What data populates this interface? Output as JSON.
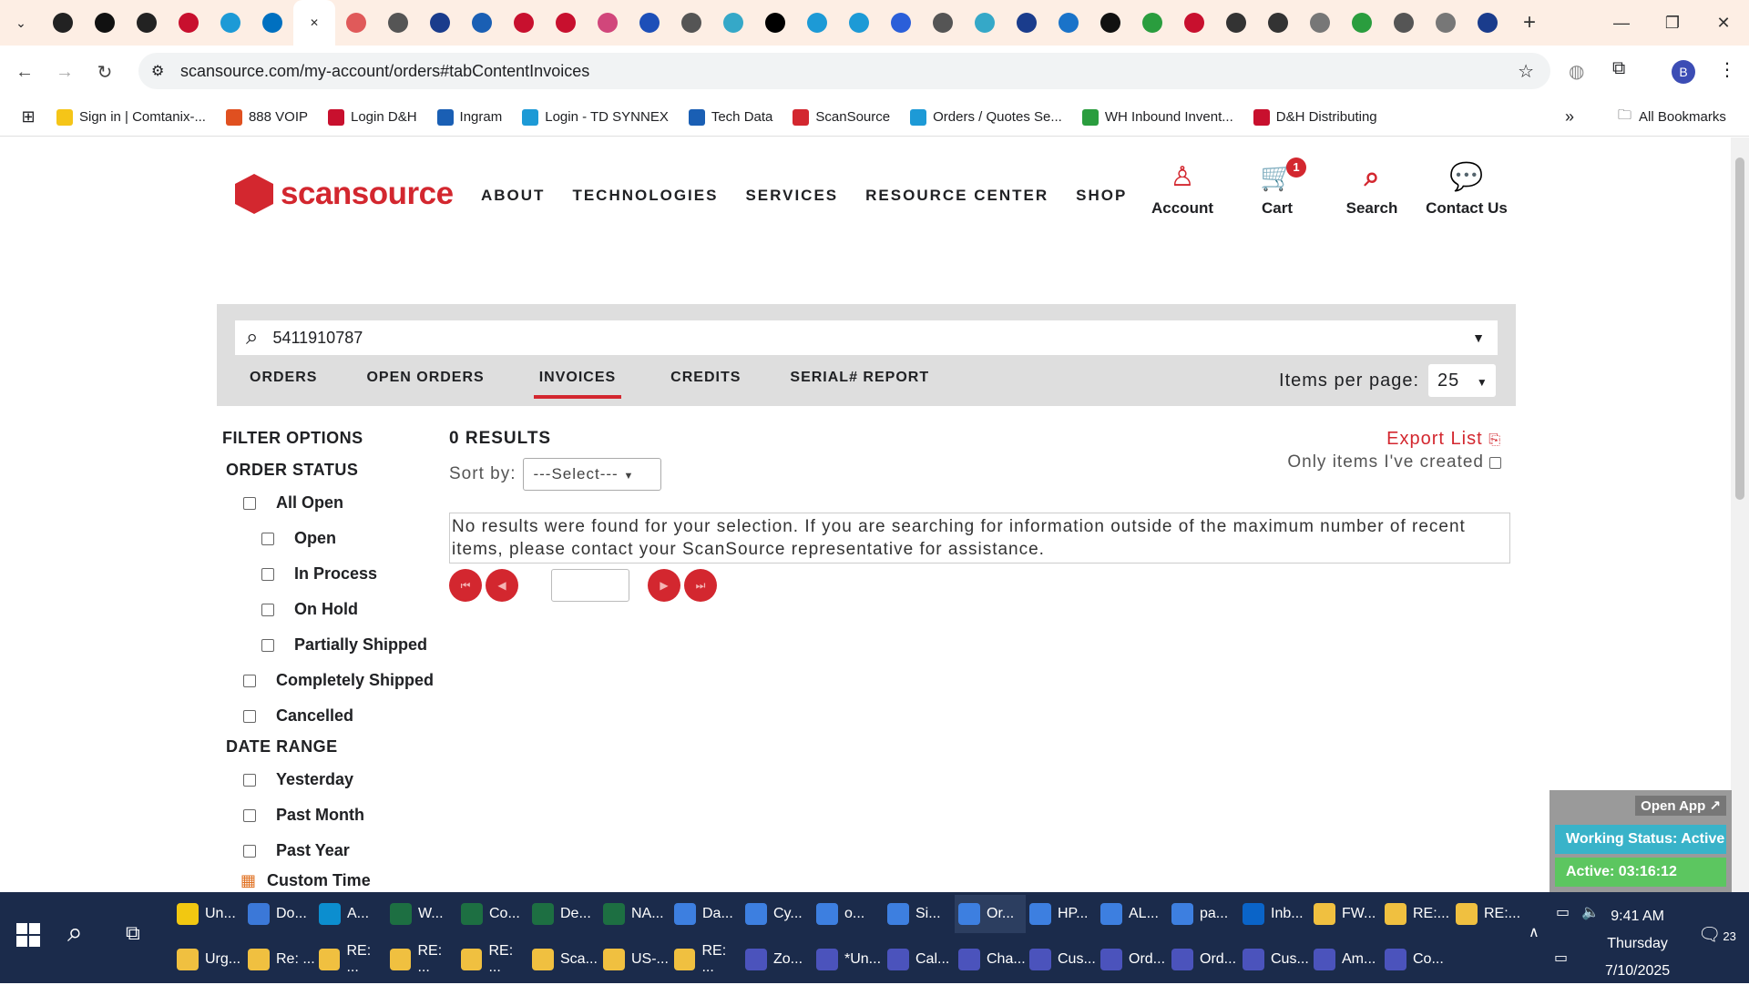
{
  "browser": {
    "url": "scansource.com/my-account/orders#tabContentInvoices",
    "tab_icons": [
      "amazon-icon",
      "amazon-icon",
      "amazon-icon",
      "dh-icon",
      "tdsynnex-icon",
      "ingram-icon",
      "close-icon",
      "tab-icon",
      "globe-icon",
      "tab-icon",
      "tab-icon",
      "tab-icon",
      "tab-icon",
      "tab-icon",
      "hp-icon",
      "globe-icon",
      "tab-icon",
      "s-icon",
      "tab-icon",
      "tab-icon",
      "tab-icon",
      "globe-icon",
      "tab-icon",
      "tab-icon",
      "tab-icon",
      "tab-icon",
      "tab-icon",
      "dh-icon",
      "tab-icon",
      "tab-icon",
      "tab-icon",
      "tab-icon",
      "tab-icon",
      "tab-icon",
      "amazon-icon"
    ],
    "bookmarks": [
      "Sign in | Comtanix-...",
      "888 VOIP",
      "Login D&H",
      "Ingram",
      "Login - TD SYNNEX",
      "Tech Data",
      "ScanSource",
      "Orders / Quotes Se...",
      "WH Inbound Invent...",
      "D&H Distributing"
    ],
    "all_bookmarks": "All Bookmarks",
    "profile_initial": "B"
  },
  "site": {
    "logo": "scansource",
    "nav": [
      "ABOUT",
      "TECHNOLOGIES",
      "SERVICES",
      "RESOURCE CENTER",
      "SHOP"
    ],
    "account": "Account",
    "cart": "Cart",
    "cart_count": "1",
    "search": "Search",
    "contact": "Contact Us"
  },
  "toolbar": {
    "search_value": "5411910787",
    "tabs": [
      "ORDERS",
      "OPEN ORDERS",
      "INVOICES",
      "CREDITS",
      "SERIAL# REPORT"
    ],
    "items_per_page_label": "Items per page:",
    "items_per_page": "25"
  },
  "filters": {
    "title": "FILTER OPTIONS",
    "order_status_title": "ORDER STATUS",
    "order_status": [
      "All Open",
      "Open",
      "In Process",
      "On Hold",
      "Partially Shipped",
      "Completely Shipped",
      "Cancelled"
    ],
    "date_range_title": "DATE RANGE",
    "date_range": [
      "Yesterday",
      "Past Month",
      "Past Year"
    ],
    "custom_time": "Custom Time"
  },
  "results": {
    "count": "0 RESULTS",
    "sort_label": "Sort by:",
    "sort_value": "---Select---",
    "export": "Export List",
    "only_mine": "Only items I've created",
    "message": "No results were found for your selection. If you are searching for information outside of the maximum number of recent items, please contact your ScanSource representative for assistance."
  },
  "widget": {
    "open_app": "Open App ↗",
    "status": "Working Status: Active",
    "active": "Active: 03:16:12"
  },
  "taskbar": {
    "row1": [
      "Un...",
      "Do...",
      "A...",
      "W...",
      "Co...",
      "De...",
      "NA...",
      "Da...",
      "Cy...",
      "o...",
      "Si...",
      "Or...",
      "HP...",
      "AL...",
      "pa...",
      "Inb...",
      "FW...",
      "RE:...",
      "RE:..."
    ],
    "row2": [
      "Urg...",
      "Re: ...",
      "RE: ...",
      "RE: ...",
      "RE: ...",
      "Sca...",
      "US-...",
      "RE: ...",
      "Zo...",
      "*Un...",
      "Cal...",
      "Cha...",
      "Cus...",
      "Ord...",
      "Ord...",
      "Cus...",
      "Am...",
      "Co..."
    ],
    "time": "9:41 AM",
    "day": "Thursday",
    "date": "7/10/2025",
    "notifications": "23"
  }
}
